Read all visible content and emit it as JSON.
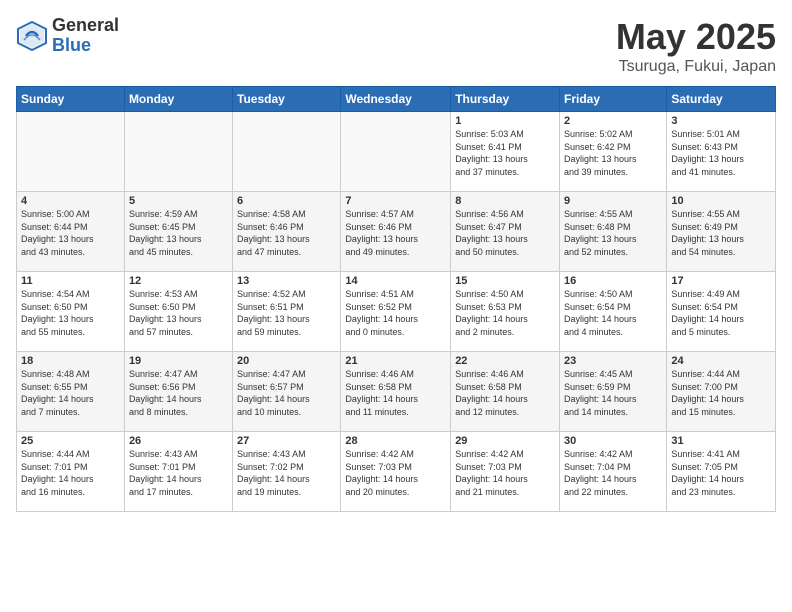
{
  "header": {
    "logo_general": "General",
    "logo_blue": "Blue",
    "month_title": "May 2025",
    "location": "Tsuruga, Fukui, Japan"
  },
  "days_of_week": [
    "Sunday",
    "Monday",
    "Tuesday",
    "Wednesday",
    "Thursday",
    "Friday",
    "Saturday"
  ],
  "weeks": [
    [
      {
        "day": "",
        "info": ""
      },
      {
        "day": "",
        "info": ""
      },
      {
        "day": "",
        "info": ""
      },
      {
        "day": "",
        "info": ""
      },
      {
        "day": "1",
        "info": "Sunrise: 5:03 AM\nSunset: 6:41 PM\nDaylight: 13 hours\nand 37 minutes."
      },
      {
        "day": "2",
        "info": "Sunrise: 5:02 AM\nSunset: 6:42 PM\nDaylight: 13 hours\nand 39 minutes."
      },
      {
        "day": "3",
        "info": "Sunrise: 5:01 AM\nSunset: 6:43 PM\nDaylight: 13 hours\nand 41 minutes."
      }
    ],
    [
      {
        "day": "4",
        "info": "Sunrise: 5:00 AM\nSunset: 6:44 PM\nDaylight: 13 hours\nand 43 minutes."
      },
      {
        "day": "5",
        "info": "Sunrise: 4:59 AM\nSunset: 6:45 PM\nDaylight: 13 hours\nand 45 minutes."
      },
      {
        "day": "6",
        "info": "Sunrise: 4:58 AM\nSunset: 6:46 PM\nDaylight: 13 hours\nand 47 minutes."
      },
      {
        "day": "7",
        "info": "Sunrise: 4:57 AM\nSunset: 6:46 PM\nDaylight: 13 hours\nand 49 minutes."
      },
      {
        "day": "8",
        "info": "Sunrise: 4:56 AM\nSunset: 6:47 PM\nDaylight: 13 hours\nand 50 minutes."
      },
      {
        "day": "9",
        "info": "Sunrise: 4:55 AM\nSunset: 6:48 PM\nDaylight: 13 hours\nand 52 minutes."
      },
      {
        "day": "10",
        "info": "Sunrise: 4:55 AM\nSunset: 6:49 PM\nDaylight: 13 hours\nand 54 minutes."
      }
    ],
    [
      {
        "day": "11",
        "info": "Sunrise: 4:54 AM\nSunset: 6:50 PM\nDaylight: 13 hours\nand 55 minutes."
      },
      {
        "day": "12",
        "info": "Sunrise: 4:53 AM\nSunset: 6:50 PM\nDaylight: 13 hours\nand 57 minutes."
      },
      {
        "day": "13",
        "info": "Sunrise: 4:52 AM\nSunset: 6:51 PM\nDaylight: 13 hours\nand 59 minutes."
      },
      {
        "day": "14",
        "info": "Sunrise: 4:51 AM\nSunset: 6:52 PM\nDaylight: 14 hours\nand 0 minutes."
      },
      {
        "day": "15",
        "info": "Sunrise: 4:50 AM\nSunset: 6:53 PM\nDaylight: 14 hours\nand 2 minutes."
      },
      {
        "day": "16",
        "info": "Sunrise: 4:50 AM\nSunset: 6:54 PM\nDaylight: 14 hours\nand 4 minutes."
      },
      {
        "day": "17",
        "info": "Sunrise: 4:49 AM\nSunset: 6:54 PM\nDaylight: 14 hours\nand 5 minutes."
      }
    ],
    [
      {
        "day": "18",
        "info": "Sunrise: 4:48 AM\nSunset: 6:55 PM\nDaylight: 14 hours\nand 7 minutes."
      },
      {
        "day": "19",
        "info": "Sunrise: 4:47 AM\nSunset: 6:56 PM\nDaylight: 14 hours\nand 8 minutes."
      },
      {
        "day": "20",
        "info": "Sunrise: 4:47 AM\nSunset: 6:57 PM\nDaylight: 14 hours\nand 10 minutes."
      },
      {
        "day": "21",
        "info": "Sunrise: 4:46 AM\nSunset: 6:58 PM\nDaylight: 14 hours\nand 11 minutes."
      },
      {
        "day": "22",
        "info": "Sunrise: 4:46 AM\nSunset: 6:58 PM\nDaylight: 14 hours\nand 12 minutes."
      },
      {
        "day": "23",
        "info": "Sunrise: 4:45 AM\nSunset: 6:59 PM\nDaylight: 14 hours\nand 14 minutes."
      },
      {
        "day": "24",
        "info": "Sunrise: 4:44 AM\nSunset: 7:00 PM\nDaylight: 14 hours\nand 15 minutes."
      }
    ],
    [
      {
        "day": "25",
        "info": "Sunrise: 4:44 AM\nSunset: 7:01 PM\nDaylight: 14 hours\nand 16 minutes."
      },
      {
        "day": "26",
        "info": "Sunrise: 4:43 AM\nSunset: 7:01 PM\nDaylight: 14 hours\nand 17 minutes."
      },
      {
        "day": "27",
        "info": "Sunrise: 4:43 AM\nSunset: 7:02 PM\nDaylight: 14 hours\nand 19 minutes."
      },
      {
        "day": "28",
        "info": "Sunrise: 4:42 AM\nSunset: 7:03 PM\nDaylight: 14 hours\nand 20 minutes."
      },
      {
        "day": "29",
        "info": "Sunrise: 4:42 AM\nSunset: 7:03 PM\nDaylight: 14 hours\nand 21 minutes."
      },
      {
        "day": "30",
        "info": "Sunrise: 4:42 AM\nSunset: 7:04 PM\nDaylight: 14 hours\nand 22 minutes."
      },
      {
        "day": "31",
        "info": "Sunrise: 4:41 AM\nSunset: 7:05 PM\nDaylight: 14 hours\nand 23 minutes."
      }
    ]
  ]
}
